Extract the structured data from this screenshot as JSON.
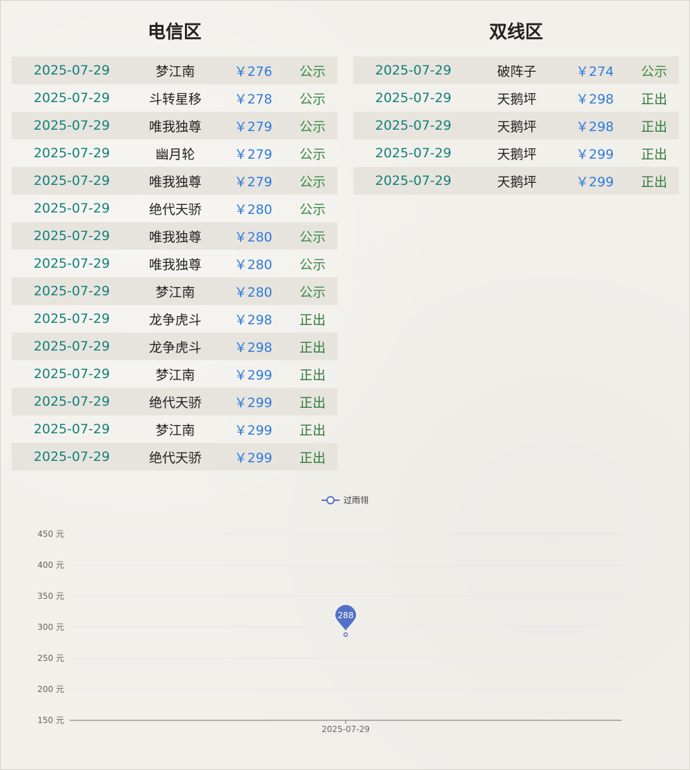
{
  "telecom": {
    "title": "电信区",
    "rows": [
      {
        "date": "2025-07-29",
        "name": "梦江南",
        "price": "￥276",
        "status": "公示"
      },
      {
        "date": "2025-07-29",
        "name": "斗转星移",
        "price": "￥278",
        "status": "公示"
      },
      {
        "date": "2025-07-29",
        "name": "唯我独尊",
        "price": "￥279",
        "status": "公示"
      },
      {
        "date": "2025-07-29",
        "name": "幽月轮",
        "price": "￥279",
        "status": "公示"
      },
      {
        "date": "2025-07-29",
        "name": "唯我独尊",
        "price": "￥279",
        "status": "公示"
      },
      {
        "date": "2025-07-29",
        "name": "绝代天骄",
        "price": "￥280",
        "status": "公示"
      },
      {
        "date": "2025-07-29",
        "name": "唯我独尊",
        "price": "￥280",
        "status": "公示"
      },
      {
        "date": "2025-07-29",
        "name": "唯我独尊",
        "price": "￥280",
        "status": "公示"
      },
      {
        "date": "2025-07-29",
        "name": "梦江南",
        "price": "￥280",
        "status": "公示"
      },
      {
        "date": "2025-07-29",
        "name": "龙争虎斗",
        "price": "￥298",
        "status": "正出"
      },
      {
        "date": "2025-07-29",
        "name": "龙争虎斗",
        "price": "￥298",
        "status": "正出"
      },
      {
        "date": "2025-07-29",
        "name": "梦江南",
        "price": "￥299",
        "status": "正出"
      },
      {
        "date": "2025-07-29",
        "name": "绝代天骄",
        "price": "￥299",
        "status": "正出"
      },
      {
        "date": "2025-07-29",
        "name": "梦江南",
        "price": "￥299",
        "status": "正出"
      },
      {
        "date": "2025-07-29",
        "name": "绝代天骄",
        "price": "￥299",
        "status": "正出"
      }
    ]
  },
  "dual": {
    "title": "双线区",
    "rows": [
      {
        "date": "2025-07-29",
        "name": "破阵子",
        "price": "￥274",
        "status": "公示"
      },
      {
        "date": "2025-07-29",
        "name": "天鹅坪",
        "price": "￥298",
        "status": "正出"
      },
      {
        "date": "2025-07-29",
        "name": "天鹅坪",
        "price": "￥298",
        "status": "正出"
      },
      {
        "date": "2025-07-29",
        "name": "天鹅坪",
        "price": "￥299",
        "status": "正出"
      },
      {
        "date": "2025-07-29",
        "name": "天鹅坪",
        "price": "￥299",
        "status": "正出"
      }
    ]
  },
  "colors": {
    "series": "#5470c6",
    "date": "#14807a",
    "price": "#2f7bd9",
    "status": "#3b8a43"
  },
  "chart_data": {
    "type": "line",
    "x": [
      "2025-07-29"
    ],
    "series": [
      {
        "name": "过雨翎",
        "values": [
          288
        ]
      }
    ],
    "ylim": [
      150,
      450
    ],
    "yticks": [
      150,
      200,
      250,
      300,
      350,
      400,
      450
    ],
    "ytick_suffix": " 元",
    "markpoint": {
      "label": "288",
      "value": 288
    },
    "grid": true,
    "legend": "top-center"
  }
}
